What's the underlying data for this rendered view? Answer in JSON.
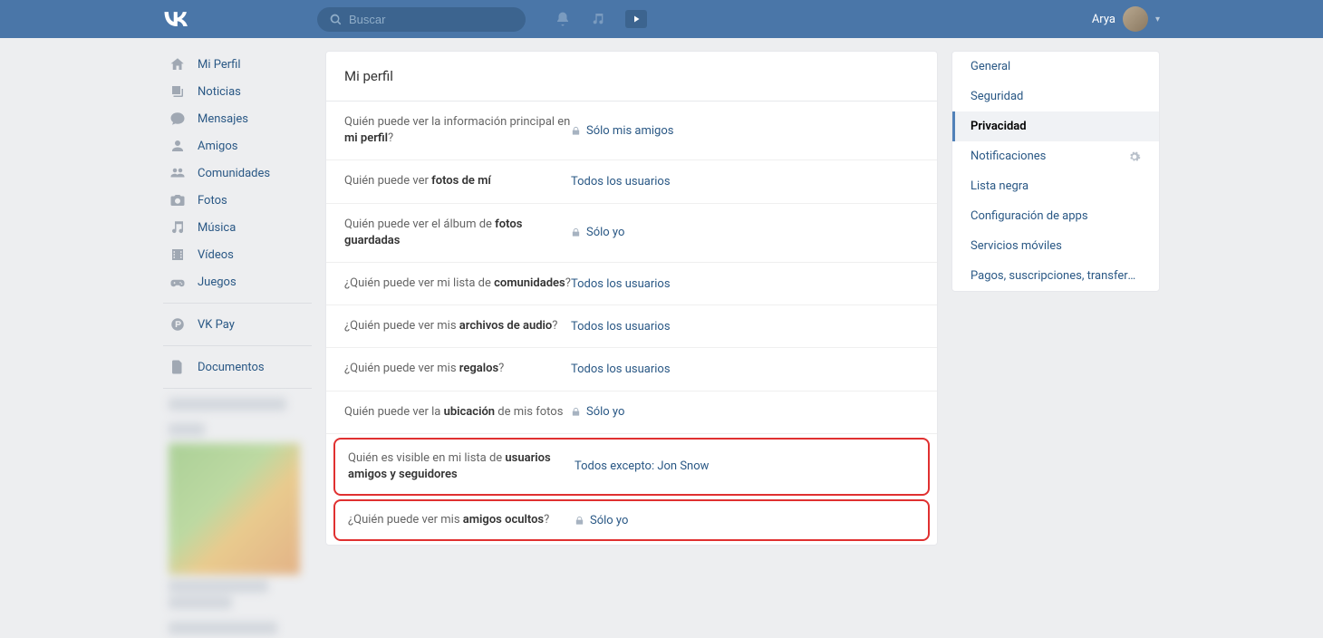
{
  "header": {
    "search_placeholder": "Buscar",
    "username": "Arya"
  },
  "leftnav": {
    "items": [
      {
        "icon": "home",
        "label": "Mi Perfil"
      },
      {
        "icon": "news",
        "label": "Noticias"
      },
      {
        "icon": "msg",
        "label": "Mensajes"
      },
      {
        "icon": "friend",
        "label": "Amigos"
      },
      {
        "icon": "group",
        "label": "Comunidades"
      },
      {
        "icon": "photo",
        "label": "Fotos"
      },
      {
        "icon": "music",
        "label": "Música"
      },
      {
        "icon": "video",
        "label": "Vídeos"
      },
      {
        "icon": "game",
        "label": "Juegos"
      }
    ],
    "pay_label": "VK Pay",
    "docs_label": "Documentos"
  },
  "main": {
    "title": "Mi perfil",
    "rows": [
      {
        "pre": "Quién puede ver la información principal en ",
        "bold": "mi perfil",
        "post": "?",
        "value": "Sólo mis amigos",
        "locked": true
      },
      {
        "pre": "Quién puede ver ",
        "bold": "fotos de mí",
        "post": "",
        "value": "Todos los usuarios",
        "locked": false
      },
      {
        "pre": "Quién puede ver el álbum de ",
        "bold": "fotos guardadas",
        "post": "",
        "value": "Sólo yo",
        "locked": true
      },
      {
        "pre": "¿Quién puede ver mi lista de ",
        "bold": "comunidades",
        "post": "?",
        "value": "Todos los usuarios",
        "locked": false
      },
      {
        "pre": "¿Quién puede ver mis ",
        "bold": "archivos de audio",
        "post": "?",
        "value": "Todos los usuarios",
        "locked": false
      },
      {
        "pre": "¿Quién puede ver mis ",
        "bold": "regalos",
        "post": "?",
        "value": "Todos los usuarios",
        "locked": false
      },
      {
        "pre": "Quién puede ver la ",
        "bold": "ubicación",
        "post": " de mis fotos",
        "value": "Sólo yo",
        "locked": true
      },
      {
        "pre": "Quién es visible en mi lista de ",
        "bold": "usuarios amigos y seguidores",
        "post": "",
        "value": "Todos excepto: Jon Snow",
        "locked": false,
        "highlight": true
      },
      {
        "pre": "¿Quién puede ver mis ",
        "bold": "amigos ocultos",
        "post": "?",
        "value": "Sólo yo",
        "locked": true,
        "highlight": true
      }
    ]
  },
  "rightnav": {
    "items": [
      {
        "label": "General"
      },
      {
        "label": "Seguridad"
      },
      {
        "label": "Privacidad",
        "active": true
      },
      {
        "label": "Notificaciones",
        "gear": true
      },
      {
        "label": "Lista negra"
      },
      {
        "label": "Configuración de apps"
      },
      {
        "label": "Servicios móviles"
      },
      {
        "label": "Pagos, suscripciones, transferencias"
      }
    ]
  }
}
